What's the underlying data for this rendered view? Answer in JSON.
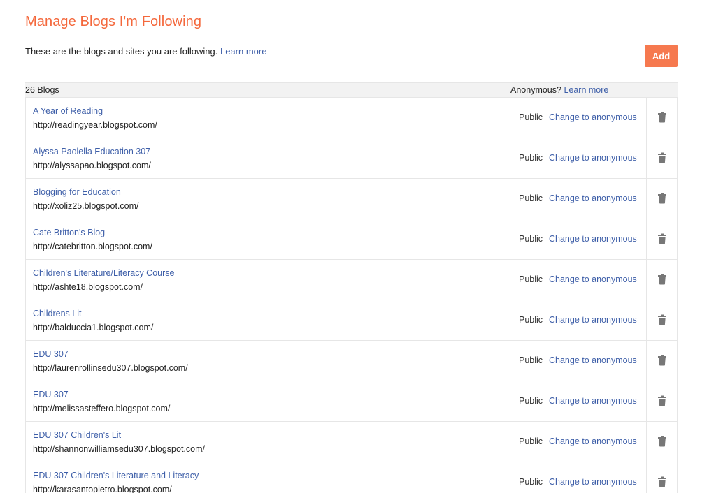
{
  "page": {
    "title": "Manage Blogs I'm Following",
    "intro_text": "These are the blogs and sites you are following.",
    "intro_link": "Learn more",
    "add_label": "Add"
  },
  "table": {
    "count_label": "26 Blogs",
    "anonymous_label": "Anonymous?",
    "anonymous_link": "Learn more",
    "rows": [
      {
        "name": "A Year of Reading",
        "url": "http://readingyear.blogspot.com/",
        "status": "Public",
        "action": "Change to anonymous"
      },
      {
        "name": "Alyssa Paolella Education 307",
        "url": "http://alyssapao.blogspot.com/",
        "status": "Public",
        "action": "Change to anonymous"
      },
      {
        "name": "Blogging for Education",
        "url": "http://xoliz25.blogspot.com/",
        "status": "Public",
        "action": "Change to anonymous"
      },
      {
        "name": "Cate Britton's Blog",
        "url": "http://catebritton.blogspot.com/",
        "status": "Public",
        "action": "Change to anonymous"
      },
      {
        "name": "Children's Literature/Literacy Course",
        "url": "http://ashte18.blogspot.com/",
        "status": "Public",
        "action": "Change to anonymous"
      },
      {
        "name": "Childrens Lit",
        "url": "http://balduccia1.blogspot.com/",
        "status": "Public",
        "action": "Change to anonymous"
      },
      {
        "name": "EDU 307",
        "url": "http://laurenrollinsedu307.blogspot.com/",
        "status": "Public",
        "action": "Change to anonymous"
      },
      {
        "name": "EDU 307",
        "url": "http://melissasteffero.blogspot.com/",
        "status": "Public",
        "action": "Change to anonymous"
      },
      {
        "name": "EDU 307 Children's Lit",
        "url": "http://shannonwilliamsedu307.blogspot.com/",
        "status": "Public",
        "action": "Change to anonymous"
      },
      {
        "name": "EDU 307 Children's Literature and Literacy",
        "url": "http://karasantopietro.blogspot.com/",
        "status": "Public",
        "action": "Change to anonymous"
      }
    ]
  },
  "icons": {
    "delete": "trash-icon"
  },
  "colors": {
    "title": "#f4683c",
    "button": "#f6794f",
    "link": "#3d5ea8",
    "icon": "#777777"
  }
}
